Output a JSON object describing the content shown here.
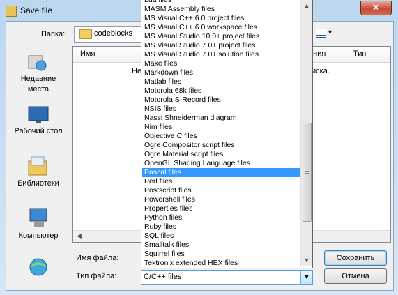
{
  "window": {
    "title": "Save file",
    "close_glyph": "✕"
  },
  "path": {
    "label": "Папка:",
    "folder": "codeblocks"
  },
  "places": [
    {
      "label": "Недавние места",
      "icon": "recent-places-icon"
    },
    {
      "label": "Рабочий стол",
      "icon": "desktop-icon"
    },
    {
      "label": "Библиотеки",
      "icon": "libraries-icon"
    },
    {
      "label": "Компьютер",
      "icon": "computer-icon"
    },
    {
      "label": "",
      "icon": "network-icon"
    }
  ],
  "filelist": {
    "columns": [
      "Имя",
      "ения",
      "Тип"
    ],
    "empty_message_left": "Не",
    "empty_message_right": "иска."
  },
  "bottom": {
    "filename_label": "Имя файла:",
    "filetype_label": "Тип файла:",
    "filetype_value": "C/C++ files",
    "save_label": "Сохранить",
    "cancel_label": "Отмена"
  },
  "dropdown": {
    "selected_index": 19,
    "items": [
      "Lua files",
      "MASM Assembly files",
      "MS Visual C++ 6.0 project files",
      "MS Visual C++ 6.0 workspace files",
      "MS Visual Studio 10.0+ project files",
      "MS Visual Studio 7.0+ project files",
      "MS Visual Studio 7.0+ solution files",
      "Make files",
      "Markdown files",
      "Matlab files",
      "Motorola 68k files",
      "Motorola S-Record files",
      "NSIS files",
      "Nassi Shneiderman diagram",
      "Nim files",
      "Objective C files",
      "Ogre Compositor script files",
      "Ogre Material script files",
      "OpenGL Shading Language files",
      "Pascal files",
      "Perl files",
      "Postscript files",
      "Powershell files",
      "Properties files",
      "Python files",
      "Ruby files",
      "SQL files",
      "Smalltalk files",
      "Squirrel files",
      "Tektronix extended HEX files"
    ]
  },
  "colors": {
    "selection": "#3399ff",
    "accent_border": "#569de5"
  }
}
